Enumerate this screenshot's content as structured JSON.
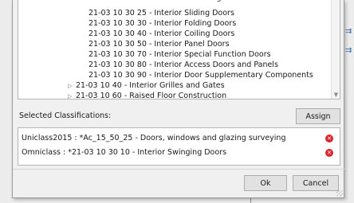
{
  "tree": {
    "items": [
      {
        "code": "21-03 10 30 25 - Interior Sliding Doors",
        "expander": false
      },
      {
        "code": "21-03 10 30 30 - Interior Folding Doors",
        "expander": false
      },
      {
        "code": "21-03 10 30 40 - Interior Coiling Doors",
        "expander": false
      },
      {
        "code": "21-03 10 30 50 - Interior Panel Doors",
        "expander": false
      },
      {
        "code": "21-03 10 30 70 - Interior Special Function Doors",
        "expander": false
      },
      {
        "code": "21-03 10 30 80 - Interior Access Doors and Panels",
        "expander": false
      },
      {
        "code": "21-03 10 30 90 - Interior Door Supplementary Components",
        "expander": false
      },
      {
        "code": "21-03 10 40 - Interior Grilles and Gates",
        "expander": true
      },
      {
        "code": "21-03 10 60 - Raised Floor Construction",
        "expander": true
      }
    ]
  },
  "selected": {
    "label": "Selected Classifications:",
    "assign_label": "Assign",
    "rows": [
      {
        "text": "Uniclass2015 : *Ac_15_50_25 - Doors, windows and glazing surveying"
      },
      {
        "text": "Omniclass : *21-03 10 30 10 - Interior Swinging Doors"
      }
    ]
  },
  "footer": {
    "ok_label": "Ok",
    "cancel_label": "Cancel"
  },
  "icons": {
    "expander": "chevron-right-icon",
    "remove": "remove-circle-icon",
    "remove_color": "#d9262c"
  }
}
